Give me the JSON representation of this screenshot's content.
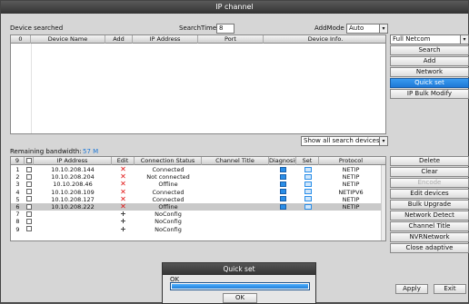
{
  "window": {
    "title": "IP channel"
  },
  "top": {
    "device_searched_label": "Device searched",
    "search_time_label": "SearchTime",
    "search_time_value": "8",
    "add_mode_label": "AddMode",
    "add_mode_value": "Auto",
    "protocol_filter": "Full Netcom",
    "columns": [
      "0",
      "Device Name",
      "Add",
      "IP Address",
      "Port",
      "Device Info."
    ],
    "show_filter": "Show all search devices"
  },
  "right_top_buttons": {
    "search": "Search",
    "add": "Add",
    "network": "Network",
    "quick_set": "Quick set",
    "ip_bulk_modify": "IP Bulk Modify"
  },
  "bandwidth": {
    "label": "Remaining bandwidth:",
    "value": "57 M"
  },
  "channels": {
    "columns": [
      "9",
      "IP Address",
      "Edit",
      "Connection Status",
      "Channel Title",
      "Diagnosis",
      "Set",
      "Protocol"
    ],
    "rows": [
      {
        "num": "1",
        "ip": "10.10.208.144",
        "edit": "x",
        "status": "Connected",
        "protocol": "NETIP"
      },
      {
        "num": "2",
        "ip": "10.10.208.204",
        "edit": "x",
        "status": "Not connected",
        "protocol": "NETIP"
      },
      {
        "num": "3",
        "ip": "10.10.208.46",
        "edit": "x",
        "status": "Offline",
        "protocol": "NETIP"
      },
      {
        "num": "4",
        "ip": "10.10.208.109",
        "edit": "x",
        "status": "Connected",
        "protocol": "NETIPV6"
      },
      {
        "num": "5",
        "ip": "10.10.208.127",
        "edit": "x",
        "status": "Connected",
        "protocol": "NETIP"
      },
      {
        "num": "6",
        "ip": "10.10.208.222",
        "edit": "x",
        "status": "Offline",
        "protocol": "NETIP"
      },
      {
        "num": "7",
        "ip": "",
        "edit": "+",
        "status": "NoConfig",
        "protocol": ""
      },
      {
        "num": "8",
        "ip": "",
        "edit": "+",
        "status": "NoConfig",
        "protocol": ""
      },
      {
        "num": "9",
        "ip": "",
        "edit": "+",
        "status": "NoConfig",
        "protocol": ""
      }
    ],
    "selected_row": 6
  },
  "right_bottom_buttons": {
    "delete": "Delete",
    "clear": "Clear",
    "encode": "Encode",
    "edit_devices": "Edit devices",
    "bulk_upgrade": "Bulk Upgrade",
    "network_detect": "Network Detect",
    "channel_title": "Channel Title",
    "nvr_network": "NVRNetwork",
    "close_adaptive": "Close adaptive"
  },
  "bottom_buttons": {
    "apply": "Apply",
    "exit": "Exit"
  },
  "dialog": {
    "title": "Quick set",
    "message": "OK",
    "progress": 1.0,
    "ok_button": "OK"
  },
  "colors": {
    "accent": "#1e78d6",
    "error": "#e01010",
    "titlebar": "#333333"
  }
}
